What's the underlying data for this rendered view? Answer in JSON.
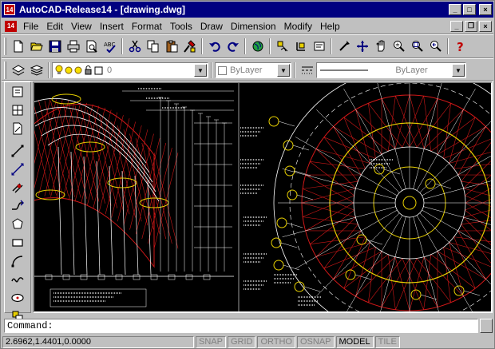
{
  "window": {
    "title": "AutoCAD-Release14 - [drawing.dwg]",
    "app_icon_text": "14",
    "minimize": "_",
    "maximize": "□",
    "close": "×"
  },
  "menubar": {
    "items": [
      "File",
      "Edit",
      "View",
      "Insert",
      "Format",
      "Tools",
      "Draw",
      "Dimension",
      "Modify",
      "Help"
    ],
    "doc_minimize": "_",
    "doc_restore": "❐",
    "doc_close": "×"
  },
  "properties_bar": {
    "layer_value": "0",
    "color_value": "ByLayer",
    "linetype_value": "ByLayer"
  },
  "command_line": {
    "prompt": "Command:"
  },
  "status_bar": {
    "coordinates": "2.6962,1.4401,0.0000",
    "modes": [
      "SNAP",
      "GRID",
      "ORTHO",
      "OSNAP",
      "MODEL",
      "TILE"
    ],
    "active_modes": [
      "MODEL"
    ]
  },
  "icons": {
    "standard_toolbar": [
      "new-icon",
      "open-icon",
      "save-icon",
      "print-icon",
      "print-preview-icon",
      "spell-check-icon",
      "cut-icon",
      "copy-icon",
      "paste-icon",
      "match-properties-icon",
      "undo-icon",
      "redo-icon",
      "launch-browser-icon",
      "object-snap-icon",
      "ucs-icon",
      "inquiry-icon",
      "redraw-icon",
      "aerial-view-icon",
      "pan-icon",
      "zoom-realtime-icon",
      "zoom-window-icon",
      "zoom-previous-icon",
      "help-icon"
    ],
    "draw_toolbar": [
      "line-icon",
      "construction-line-icon",
      "multiline-icon",
      "polyline-icon",
      "polygon-icon",
      "rectangle-icon",
      "arc-icon",
      "circle-icon",
      "spline-icon",
      "ellipse-icon",
      "insert-block-icon"
    ]
  },
  "colors": {
    "titlebar": "#000080",
    "canvas": "#000000",
    "drawing_white": "#ffffff",
    "drawing_red": "#d01818",
    "drawing_yellow": "#e8d000"
  }
}
